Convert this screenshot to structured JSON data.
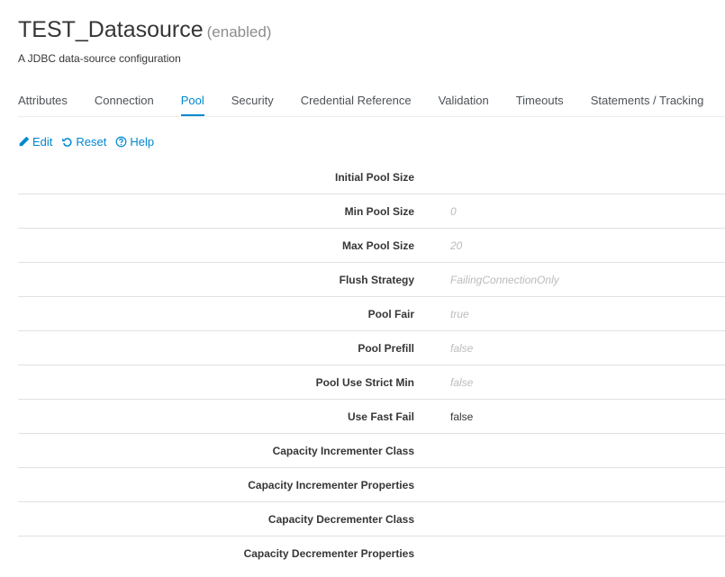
{
  "header": {
    "title": "TEST_Datasource",
    "status": "(enabled)",
    "subtitle": "A JDBC data-source configuration"
  },
  "tabs": [
    {
      "label": "Attributes",
      "active": false
    },
    {
      "label": "Connection",
      "active": false
    },
    {
      "label": "Pool",
      "active": true
    },
    {
      "label": "Security",
      "active": false
    },
    {
      "label": "Credential Reference",
      "active": false
    },
    {
      "label": "Validation",
      "active": false
    },
    {
      "label": "Timeouts",
      "active": false
    },
    {
      "label": "Statements / Tracking",
      "active": false
    }
  ],
  "toolbar": {
    "edit_label": "Edit",
    "reset_label": "Reset",
    "help_label": "Help",
    "edit_icon": "pencil-icon",
    "reset_icon": "undo-icon",
    "help_icon": "question-circle-icon"
  },
  "attributes": [
    {
      "label": "Initial Pool Size",
      "value": "",
      "is_default": false
    },
    {
      "label": "Min Pool Size",
      "value": "0",
      "is_default": true
    },
    {
      "label": "Max Pool Size",
      "value": "20",
      "is_default": true
    },
    {
      "label": "Flush Strategy",
      "value": "FailingConnectionOnly",
      "is_default": true
    },
    {
      "label": "Pool Fair",
      "value": "true",
      "is_default": true
    },
    {
      "label": "Pool Prefill",
      "value": "false",
      "is_default": true
    },
    {
      "label": "Pool Use Strict Min",
      "value": "false",
      "is_default": true
    },
    {
      "label": "Use Fast Fail",
      "value": "false",
      "is_default": false
    },
    {
      "label": "Capacity Incrementer Class",
      "value": "",
      "is_default": false
    },
    {
      "label": "Capacity Incrementer Properties",
      "value": "",
      "is_default": false
    },
    {
      "label": "Capacity Decrementer Class",
      "value": "",
      "is_default": false
    },
    {
      "label": "Capacity Decrementer Properties",
      "value": "",
      "is_default": false
    }
  ],
  "colors": {
    "accent": "#0088ce",
    "text": "#363636",
    "default_value": "#bbbbbb",
    "divider": "#e1e1e1"
  }
}
